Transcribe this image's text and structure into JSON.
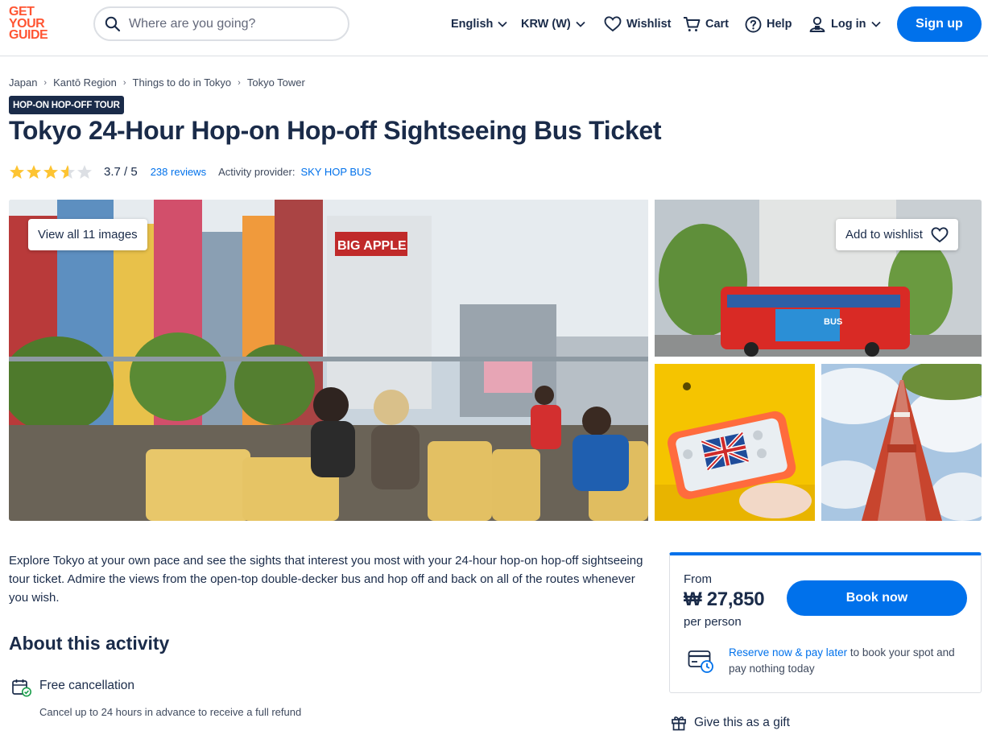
{
  "header": {
    "logo_lines": [
      "GET",
      "YOUR",
      "GUIDE"
    ],
    "search_placeholder": "Where are you going?",
    "language": "English",
    "currency": "KRW (W)",
    "wishlist": "Wishlist",
    "cart": "Cart",
    "help": "Help",
    "login": "Log in",
    "signup": "Sign up"
  },
  "breadcrumb": [
    "Japan",
    "Kantō Region",
    "Things to do in Tokyo",
    "Tokyo Tower"
  ],
  "badge": "HOP-ON HOP-OFF TOUR",
  "title": "Tokyo 24-Hour Hop-on Hop-off Sightseeing Bus Ticket",
  "rating": {
    "stars": 3.7,
    "value_text": "3.7 / 5",
    "reviews": "238 reviews",
    "provider_label": "Activity provider:",
    "provider": "SKY HOP BUS"
  },
  "gallery": {
    "view_all": "View all 11 images",
    "add_wishlist": "Add to wishlist"
  },
  "description": "Explore Tokyo at your own pace and see the sights that interest you most with your 24-hour hop-on hop-off sightseeing tour ticket. Admire the views from the open-top double-decker bus and hop off and back on all of the routes whenever you wish.",
  "about": {
    "heading": "About this activity",
    "features": [
      {
        "title": "Free cancellation",
        "subtitle": "Cancel up to 24 hours in advance to receive a full refund"
      }
    ]
  },
  "booking": {
    "from": "From",
    "price": "₩ 27,850",
    "per": "per person",
    "button": "Book now",
    "reserve_link": "Reserve now & pay later",
    "reserve_rest": " to book your spot and pay nothing today"
  },
  "gift": "Give this as a gift",
  "colors": {
    "brand_orange": "#ff5533",
    "primary_blue": "#0071eb",
    "navy": "#1a2b49",
    "star": "#fdc432"
  }
}
